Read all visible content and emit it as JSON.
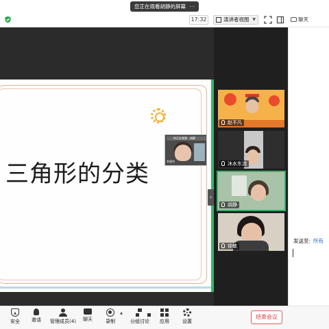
{
  "banner": {
    "sharing_text": "您正在观看胡静的屏幕",
    "more_label": "⋯"
  },
  "toolbar": {
    "timer": "17:32",
    "view_label": "演讲者视图",
    "chat_label": "聊天"
  },
  "slide": {
    "title": "三角形的分类"
  },
  "mini_cam": {
    "header": "你正在观看…胡静",
    "name": "冬候鸟"
  },
  "gallery": [
    {
      "name": "赵不凡"
    },
    {
      "name": "沐水东流"
    },
    {
      "name": "胡静"
    },
    {
      "name": "徐敏"
    }
  ],
  "chat": {
    "send_to_label": "发送至:",
    "recipient": "所有"
  },
  "controls": {
    "security": "安全",
    "invite": "邀请",
    "members": "管理成员(4)",
    "chat": "聊天",
    "record": "录制",
    "breakout": "分组讨论",
    "apps": "应用",
    "settings": "设置",
    "end_meeting": "结束会议"
  },
  "colors": {
    "active_speaker": "#36b36a",
    "end_button": "#e04444",
    "stage_bg": "#2b2b2b"
  }
}
